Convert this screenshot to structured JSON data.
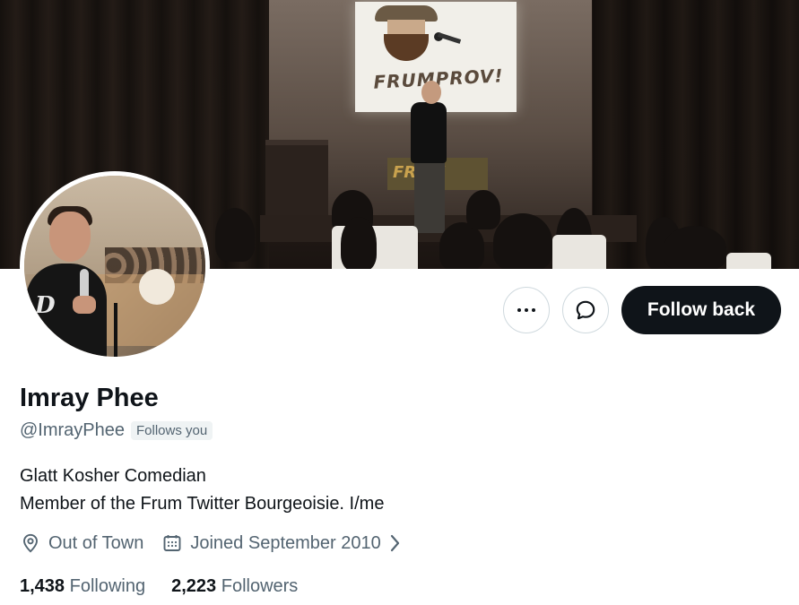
{
  "banner": {
    "screen_logo_text": "FRUMPROV!",
    "stage_sign_text": "FRUM"
  },
  "actions": {
    "more_icon": "ellipsis-icon",
    "message_icon": "message-bubble-icon",
    "follow_back_label": "Follow back"
  },
  "profile": {
    "display_name": "Imray Phee",
    "handle": "@ImrayPhee",
    "follows_you_badge": "Follows you",
    "bio_lines": [
      "Glatt Kosher Comedian",
      "Member of the Frum Twitter Bourgeoisie. I/me"
    ],
    "location": "Out of Town",
    "joined": "Joined September 2010",
    "following_count": "1,438",
    "following_label": "Following",
    "followers_count": "2,223",
    "followers_label": "Followers"
  },
  "colors": {
    "primary_text": "#0f1419",
    "secondary_text": "#536471",
    "follow_button_bg": "#0f1419",
    "border": "#cfd9de"
  }
}
